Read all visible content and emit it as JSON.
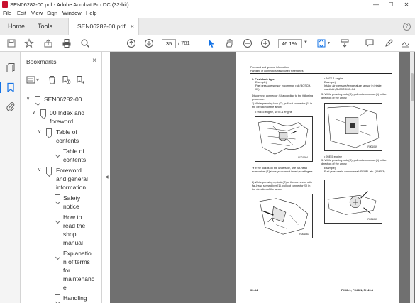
{
  "window": {
    "title": "SEN06282-00.pdf - Adobe Acrobat Pro DC (32-bit)",
    "minimize": "—",
    "maximize": "☐",
    "close": "✕"
  },
  "menu": [
    "File",
    "Edit",
    "View",
    "Sign",
    "Window",
    "Help"
  ],
  "tabs": {
    "home": "Home",
    "tools": "Tools",
    "document": "SEN06282-00.pdf",
    "close": "×",
    "help": "?"
  },
  "toolbar": {
    "current_page": "35",
    "page_total": "/ 781",
    "zoom": "46.1%"
  },
  "bookmarks": {
    "header": "Bookmarks",
    "close": "×",
    "items": [
      {
        "label": "SEN06282-00",
        "level": 0,
        "expanded": true
      },
      {
        "label": "00 Index and foreword",
        "level": 1,
        "expanded": true
      },
      {
        "label": "Table of contents",
        "level": 2,
        "expanded": true
      },
      {
        "label": "Table of contents",
        "level": 3,
        "leaf": true
      },
      {
        "label": "Foreword and general information",
        "level": 2,
        "expanded": true
      },
      {
        "label": "Safety notice",
        "level": 3,
        "leaf": true
      },
      {
        "label": "How to read the shop manual",
        "level": 3,
        "leaf": true
      },
      {
        "label": "Explanation of terms for maintenance",
        "level": 3,
        "leaf": true
      },
      {
        "label": "Handling",
        "level": 3,
        "leaf": true
      }
    ]
  },
  "page": {
    "header_line1": "Foreword and general information",
    "header_line2": "Handling of connectors newly used for engines",
    "left_col": {
      "item_head": "3. Push lock type",
      "example": "Example)",
      "example_text": "Fuel pressure sensor in common rail (BOSCH-03)",
      "instruction": "Disconnect connector (1) according to the following procedure.",
      "step1": "1) While pressing lock (C), pull out connector (1) in the direction of the arrow.",
      "variant": "• 95E-5 engine, 107E-1 engine",
      "fig1_label": "RJ01064",
      "note": "★ If the lock is on the underside, use flat-head screwdriver [1] since you cannot insert your fingers.",
      "step2": "2) While pressing up lock (C) of the connector with flat-head screwdriver [1], pull out connector (1) in the direction of the arrow.",
      "fig2_label": "RJ01063"
    },
    "right_col": {
      "variant1": "• 107E-1 engine",
      "example": "Example)",
      "example_text": "Intake air pressure/temperature sensor in intake manifold (SUMITOMO-04)",
      "step3": "3) While pressing lock (C), pull out connector (1) in the direction of the arrow.",
      "fig1_label": "RJ01069",
      "variant2": "• 95E-5 engine",
      "step4": "3) While pressing lock (C), pull out connector (1) in the direction of the arrow.",
      "example2": "Example)",
      "example2_text": "Fuel pressure in common rail: PFUEL etc. (AMP-3)",
      "fig2_label": "RJ01067"
    },
    "footer_left": "00-34",
    "footer_right": "PH40-1, PH46-1, PH49-1"
  },
  "colors": {
    "acrobat_red": "#c8102e",
    "accent_blue": "#1473e6",
    "viewer_bg": "#707070"
  }
}
